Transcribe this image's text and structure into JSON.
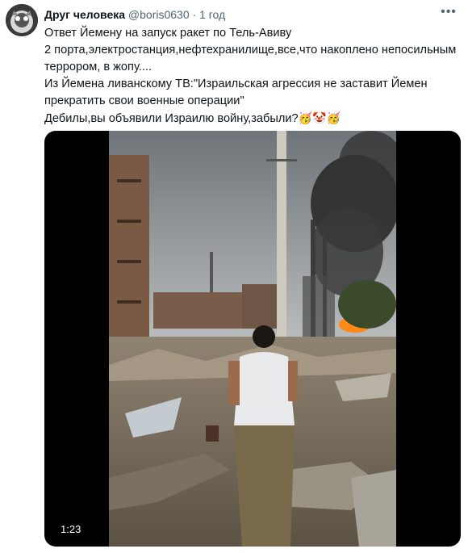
{
  "tweet": {
    "author_name": "Друг человека",
    "handle": "@boris0630",
    "separator": "·",
    "time": "1 год",
    "more_icon": "ellipsis-icon",
    "lines": [
      "Ответ Йемену на запуск ракет по Тель-Авиву",
      "2 порта,электростанция,нефтехранилище,все,что накоплено непосильным террором, в жопу....",
      "Из Йемена ливанскому ТВ:\"Израильская агрессия не заставит Йемен прекратить свои военные операции\"",
      "Дебилы,вы объявили Израилю войну,забыли?"
    ],
    "emojis": [
      "🥳",
      "🤡",
      "🥳"
    ]
  },
  "video": {
    "duration": "1:23"
  }
}
